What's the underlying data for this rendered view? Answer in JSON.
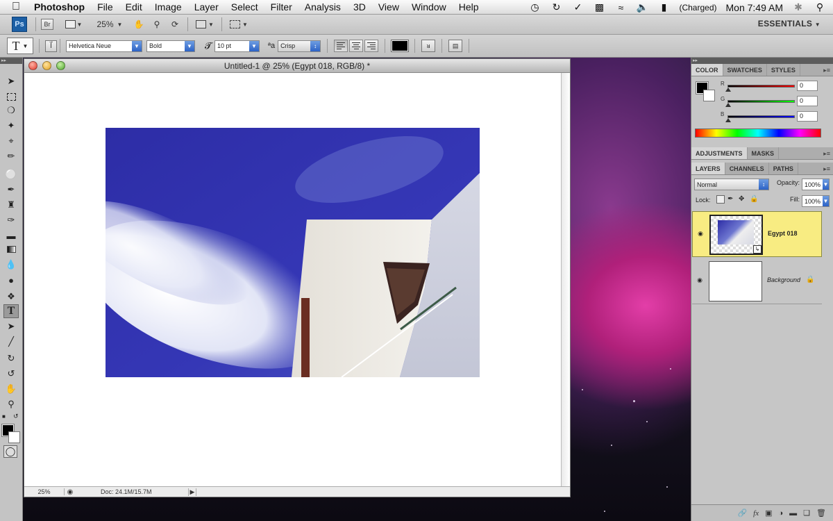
{
  "menubar": {
    "app_name": "Photoshop",
    "items": [
      "File",
      "Edit",
      "Image",
      "Layer",
      "Select",
      "Filter",
      "Analysis",
      "3D",
      "View",
      "Window",
      "Help"
    ],
    "battery_status": "(Charged)",
    "clock": "Mon 7:49 AM"
  },
  "appbar": {
    "logo_text": "Ps",
    "bridge_text": "Br",
    "zoom": "25%",
    "workspace": "ESSENTIALS"
  },
  "options": {
    "tool_glyph": "T",
    "font_family": "Helvetica Neue",
    "font_style": "Bold",
    "font_size": "10 pt",
    "aa_glyph": "ªa",
    "antialias": "Crisp"
  },
  "document": {
    "title": "Untitled-1 @ 25% (Egypt 018, RGB/8) *",
    "zoom": "25%",
    "doc_info": "Doc: 24.1M/15.7M"
  },
  "color_panel": {
    "tabs": [
      "COLOR",
      "SWATCHES",
      "STYLES"
    ],
    "r_label": "R",
    "r_value": "0",
    "g_label": "G",
    "g_value": "0",
    "b_label": "B",
    "b_value": "0"
  },
  "adjust_panel": {
    "tabs": [
      "ADJUSTMENTS",
      "MASKS"
    ]
  },
  "layers_panel": {
    "tabs": [
      "LAYERS",
      "CHANNELS",
      "PATHS"
    ],
    "blend_mode": "Normal",
    "opacity_label": "Opacity:",
    "opacity": "100%",
    "lock_label": "Lock:",
    "fill_label": "Fill:",
    "fill": "100%",
    "layers": [
      {
        "name": "Egypt 018",
        "selected": true
      },
      {
        "name": "Background",
        "selected": false
      }
    ]
  },
  "colors": {
    "accent_blue": "#2c62c6",
    "selected_layer": "#f8ec82",
    "sky_blue": "#3334b8"
  }
}
